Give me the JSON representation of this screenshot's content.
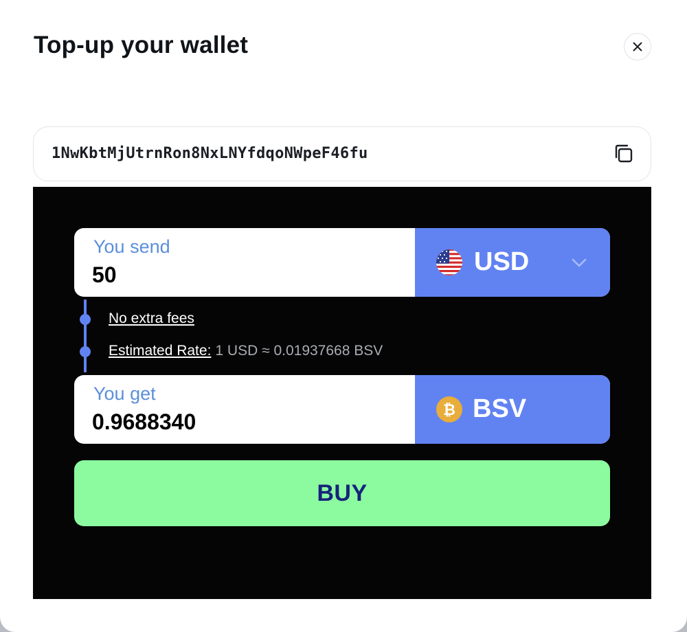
{
  "modal": {
    "title": "Top-up your wallet",
    "close_icon": "close-icon"
  },
  "wallet": {
    "address": "1NwKbtMjUtrnRon8NxLNYfdqoNWpeF46fu",
    "copy_icon": "copy-icon"
  },
  "exchange": {
    "send": {
      "label": "You send",
      "value": "50",
      "currency": "USD",
      "currency_icon": "us-flag-icon"
    },
    "fees_text": "No extra fees",
    "rate": {
      "label": "Estimated Rate:",
      "value": "1 USD ≈ 0.01937668 BSV"
    },
    "get": {
      "label": "You get",
      "value": "0.9688340",
      "currency": "BSV",
      "currency_icon": "bitcoin-icon"
    },
    "buy_label": "BUY"
  },
  "colors": {
    "accent_blue": "#6183f2",
    "buy_green": "#8cfba0",
    "buy_text": "#16237a",
    "label_blue": "#5b8fd9",
    "widget_bg": "#050505",
    "bitcoin_gold": "#e8ad3a"
  }
}
